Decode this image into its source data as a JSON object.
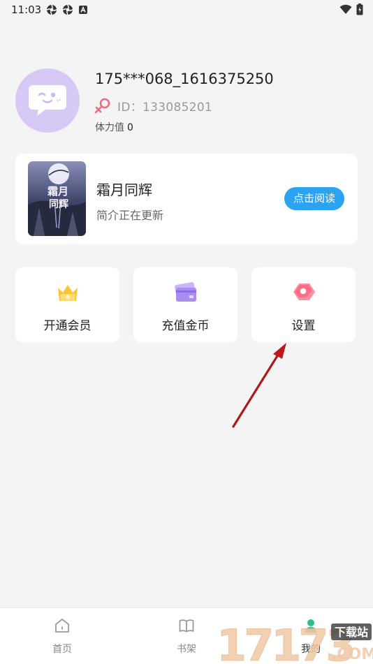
{
  "status_bar": {
    "time": "11:03"
  },
  "profile": {
    "username": "175***068_1616375250",
    "id_label": "ID：133085201",
    "stamina_label": "体力值",
    "stamina_value": "0"
  },
  "book": {
    "title": "霜月同辉",
    "description": "简介正在更新",
    "read_button": "点击阅读",
    "cover_text": "霜月同辉"
  },
  "actions": [
    {
      "label": "开通会员",
      "icon": "vip-crown-icon",
      "color": "#ffc531"
    },
    {
      "label": "充值金币",
      "icon": "wallet-card-icon",
      "color": "#a98cf0"
    },
    {
      "label": "设置",
      "icon": "settings-hexagon-icon",
      "color": "#ff7a8e"
    }
  ],
  "bottom_nav": [
    {
      "label": "首页",
      "icon": "home-icon"
    },
    {
      "label": "书架",
      "icon": "bookshelf-icon"
    },
    {
      "label": "我的",
      "icon": "mine-icon",
      "active": true
    }
  ],
  "watermark": {
    "number": "17173",
    "tag": "下载站",
    "domain": ".COM"
  },
  "colors": {
    "accent": "#2aa3f2",
    "avatar_bg": "#d7c9f6",
    "page_bg": "#f4f4f4"
  }
}
